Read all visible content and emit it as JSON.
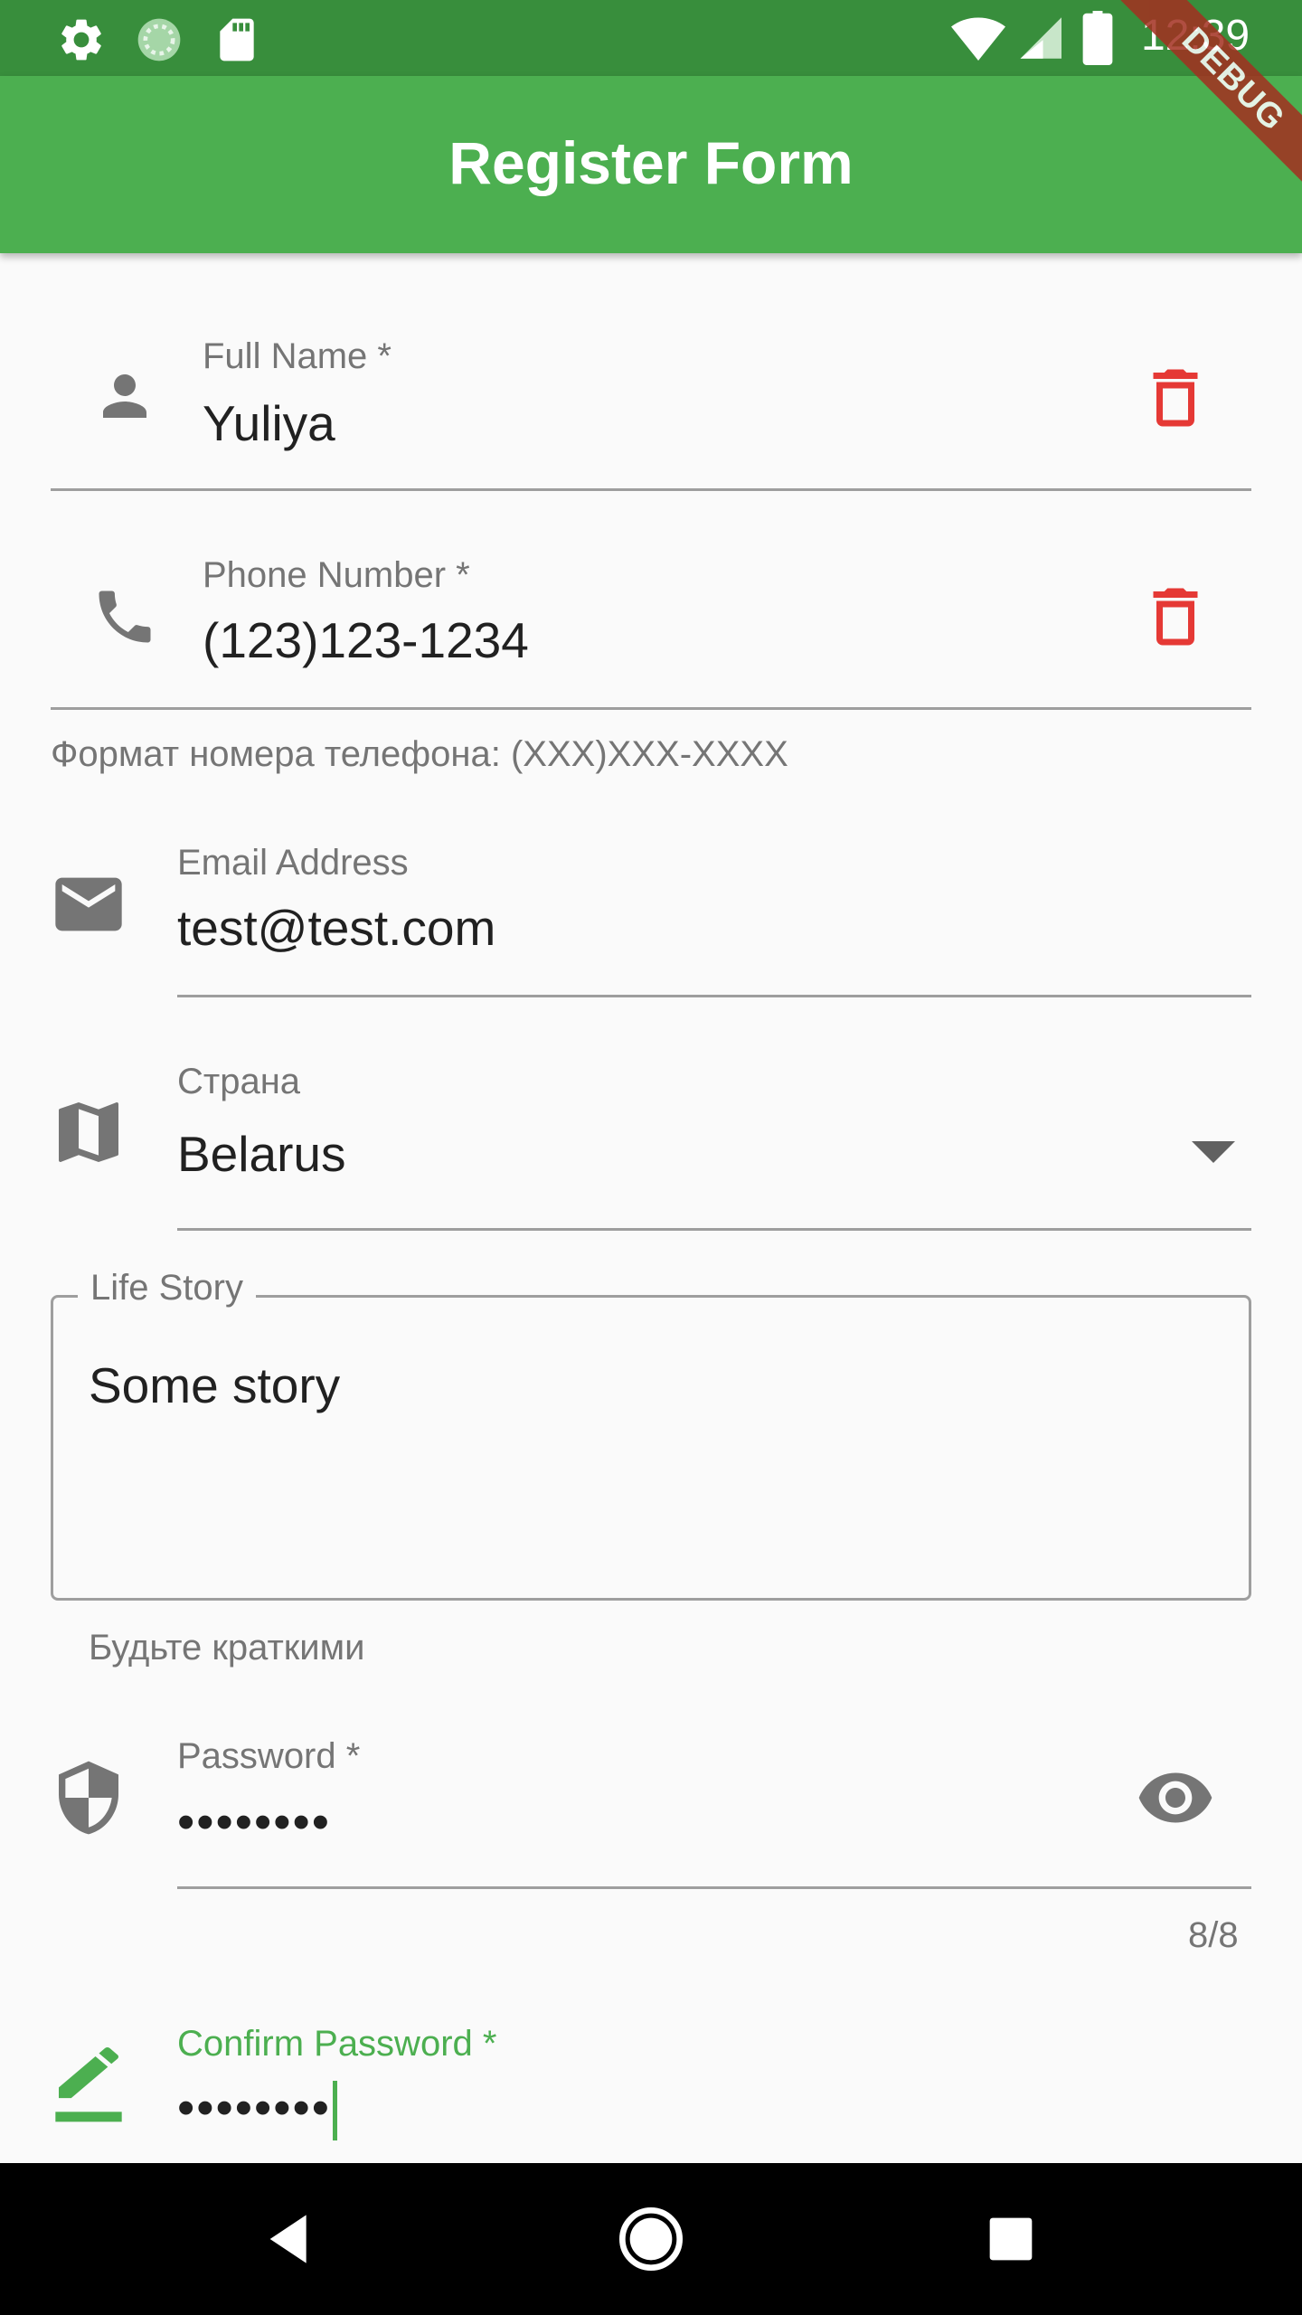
{
  "status_bar": {
    "time": "12:39",
    "left_icons": [
      "settings-icon",
      "sync-icon",
      "sd-card-icon"
    ],
    "right_icons": [
      "wifi-icon",
      "signal-icon",
      "battery-icon"
    ]
  },
  "debug_banner": "DEBUG",
  "app_bar": {
    "title": "Register Form"
  },
  "colors": {
    "primary": "#4caf50",
    "primary_dark": "#388e3c",
    "delete": "#e53935",
    "label": "#757575"
  },
  "form": {
    "full_name": {
      "label": "Full Name *",
      "value": "Yuliya",
      "icon": "person-icon",
      "action_icon": "delete-icon"
    },
    "phone": {
      "label": "Phone Number *",
      "value": "(123)123-1234",
      "helper": "Формат номера телефона: (XXX)XXX-XXXX",
      "icon": "phone-icon",
      "action_icon": "delete-icon"
    },
    "email": {
      "label": "Email Address",
      "value": "test@test.com",
      "icon": "email-icon"
    },
    "country": {
      "label": "Страна",
      "value": "Belarus",
      "icon": "map-icon"
    },
    "life_story": {
      "label": "Life Story",
      "value": "Some story",
      "helper": "Будьте краткими"
    },
    "password": {
      "label": "Password *",
      "value": "••••••••",
      "counter": "8/8",
      "icon": "shield-icon",
      "action_icon": "eye-icon"
    },
    "confirm_password": {
      "label": "Confirm Password *",
      "value": "••••••••",
      "icon": "edit-icon"
    }
  },
  "nav_bar": {
    "icons": [
      "back-icon",
      "home-icon",
      "recents-icon"
    ]
  }
}
